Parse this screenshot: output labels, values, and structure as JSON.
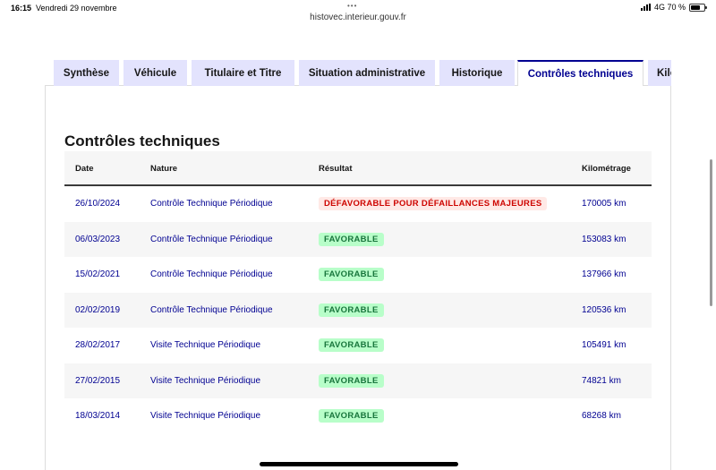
{
  "status_bar": {
    "time": "16:15",
    "date": "Vendredi 29 novembre",
    "dots": "•••",
    "network": "4G 70 %",
    "battery_percent": 70
  },
  "browser": {
    "url": "histovec.interieur.gouv.fr"
  },
  "tabs": [
    {
      "label": "Synthèse",
      "active": false
    },
    {
      "label": "Véhicule",
      "active": false
    },
    {
      "label": "Titulaire et Titre",
      "active": false
    },
    {
      "label": "Situation administrative",
      "active": false
    },
    {
      "label": "Historique",
      "active": false
    },
    {
      "label": "Contrôles techniques",
      "active": true
    },
    {
      "label": "Kilo",
      "active": false
    }
  ],
  "section": {
    "title": "Contrôles techniques"
  },
  "table": {
    "headers": {
      "date": "Date",
      "nature": "Nature",
      "result": "Résultat",
      "km": "Kilométrage"
    },
    "rows": [
      {
        "date": "26/10/2024",
        "nature": "Contrôle Technique Périodique",
        "result": "DÉFAVORABLE POUR DÉFAILLANCES MAJEURES",
        "status": "ko",
        "km": "170005 km"
      },
      {
        "date": "06/03/2023",
        "nature": "Contrôle Technique Périodique",
        "result": "FAVORABLE",
        "status": "ok",
        "km": "153083 km"
      },
      {
        "date": "15/02/2021",
        "nature": "Contrôle Technique Périodique",
        "result": "FAVORABLE",
        "status": "ok",
        "km": "137966 km"
      },
      {
        "date": "02/02/2019",
        "nature": "Contrôle Technique Périodique",
        "result": "FAVORABLE",
        "status": "ok",
        "km": "120536 km"
      },
      {
        "date": "28/02/2017",
        "nature": "Visite Technique Périodique",
        "result": "FAVORABLE",
        "status": "ok",
        "km": "105491 km"
      },
      {
        "date": "27/02/2015",
        "nature": "Visite Technique Périodique",
        "result": "FAVORABLE",
        "status": "ok",
        "km": "74821 km"
      },
      {
        "date": "18/03/2014",
        "nature": "Visite Technique Périodique",
        "result": "FAVORABLE",
        "status": "ok",
        "km": "68268 km"
      }
    ]
  },
  "colors": {
    "accent": "#000091",
    "tab_bg": "#e3e3fd",
    "success_bg": "#b8fec9",
    "success_text": "#18753c",
    "error_bg": "#ffe9e6",
    "error_text": "#ce0500"
  }
}
